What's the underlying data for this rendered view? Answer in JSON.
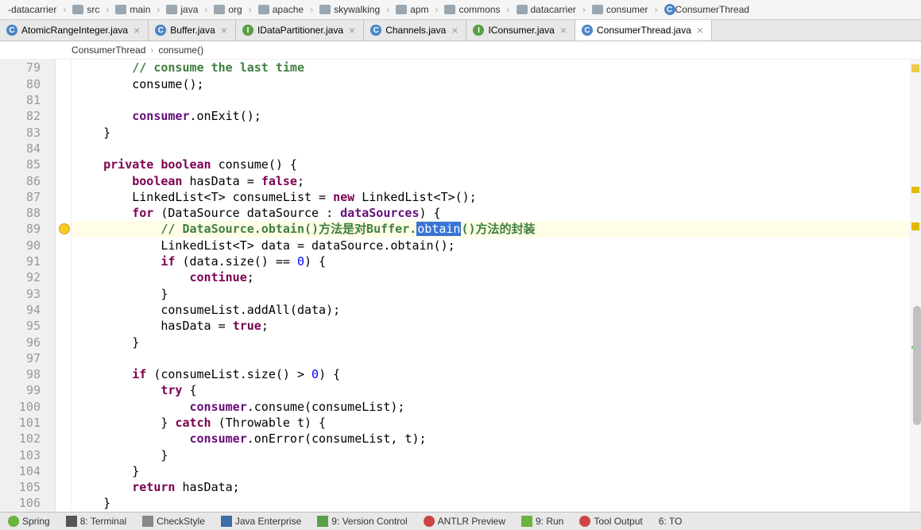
{
  "breadcrumbs": [
    "-datacarrier",
    "src",
    "main",
    "java",
    "org",
    "apache",
    "skywalking",
    "apm",
    "commons",
    "datacarrier",
    "consumer",
    "ConsumerThread"
  ],
  "bc_last_type": "class",
  "tabs": [
    {
      "icon": "c",
      "label": "AtomicRangeInteger.java",
      "active": false
    },
    {
      "icon": "c",
      "label": "Buffer.java",
      "active": false
    },
    {
      "icon": "i",
      "label": "IDataPartitioner.java",
      "active": false
    },
    {
      "icon": "c",
      "label": "Channels.java",
      "active": false
    },
    {
      "icon": "i",
      "label": "IConsumer.java",
      "active": false
    },
    {
      "icon": "c",
      "label": "ConsumerThread.java",
      "active": true
    }
  ],
  "navpath": {
    "class": "ConsumerThread",
    "method": "consume()"
  },
  "lines": {
    "start": 79,
    "end": 106,
    "highlighted": 89
  },
  "code": {
    "79": [
      {
        "t": "        ",
        "c": ""
      },
      {
        "t": "// consume the last time",
        "c": "comment-strong"
      }
    ],
    "80": [
      {
        "t": "        consume();",
        "c": ""
      }
    ],
    "81": [
      {
        "t": "",
        "c": ""
      }
    ],
    "82": [
      {
        "t": "        ",
        "c": ""
      },
      {
        "t": "consumer",
        "c": "field"
      },
      {
        "t": ".onExit();",
        "c": ""
      }
    ],
    "83": [
      {
        "t": "    }",
        "c": ""
      }
    ],
    "84": [
      {
        "t": "",
        "c": ""
      }
    ],
    "85": [
      {
        "t": "    ",
        "c": ""
      },
      {
        "t": "private boolean",
        "c": "kw"
      },
      {
        "t": " consume() {",
        "c": ""
      }
    ],
    "86": [
      {
        "t": "        ",
        "c": ""
      },
      {
        "t": "boolean",
        "c": "kw"
      },
      {
        "t": " hasData = ",
        "c": ""
      },
      {
        "t": "false",
        "c": "kw"
      },
      {
        "t": ";",
        "c": ""
      }
    ],
    "87": [
      {
        "t": "        LinkedList<",
        "c": ""
      },
      {
        "t": "T",
        "c": "type"
      },
      {
        "t": "> consumeList = ",
        "c": ""
      },
      {
        "t": "new",
        "c": "kw"
      },
      {
        "t": " LinkedList<",
        "c": ""
      },
      {
        "t": "T",
        "c": "type"
      },
      {
        "t": ">();",
        "c": ""
      }
    ],
    "88": [
      {
        "t": "        ",
        "c": ""
      },
      {
        "t": "for",
        "c": "kw"
      },
      {
        "t": " (DataSource dataSource : ",
        "c": ""
      },
      {
        "t": "dataSources",
        "c": "field"
      },
      {
        "t": ") {",
        "c": ""
      }
    ],
    "89": [
      {
        "t": "            ",
        "c": ""
      },
      {
        "t": "// DataSource.obtain()方法是对Buffer.",
        "c": "comment-strong"
      },
      {
        "t": "obtain",
        "c": "sel"
      },
      {
        "t": "()方法的封装",
        "c": "comment-strong"
      }
    ],
    "90": [
      {
        "t": "            LinkedList<",
        "c": ""
      },
      {
        "t": "T",
        "c": "type"
      },
      {
        "t": "> data = dataSource.obtain();",
        "c": ""
      }
    ],
    "91": [
      {
        "t": "            ",
        "c": ""
      },
      {
        "t": "if",
        "c": "kw"
      },
      {
        "t": " (data.size() == ",
        "c": ""
      },
      {
        "t": "0",
        "c": "num"
      },
      {
        "t": ") {",
        "c": ""
      }
    ],
    "92": [
      {
        "t": "                ",
        "c": ""
      },
      {
        "t": "continue",
        "c": "kw"
      },
      {
        "t": ";",
        "c": ""
      }
    ],
    "93": [
      {
        "t": "            }",
        "c": ""
      }
    ],
    "94": [
      {
        "t": "            consumeList.addAll(data);",
        "c": ""
      }
    ],
    "95": [
      {
        "t": "            hasData = ",
        "c": ""
      },
      {
        "t": "true",
        "c": "kw"
      },
      {
        "t": ";",
        "c": ""
      }
    ],
    "96": [
      {
        "t": "        }",
        "c": ""
      }
    ],
    "97": [
      {
        "t": "",
        "c": ""
      }
    ],
    "98": [
      {
        "t": "        ",
        "c": ""
      },
      {
        "t": "if",
        "c": "kw"
      },
      {
        "t": " (consumeList.size() > ",
        "c": ""
      },
      {
        "t": "0",
        "c": "num"
      },
      {
        "t": ") {",
        "c": ""
      }
    ],
    "99": [
      {
        "t": "            ",
        "c": ""
      },
      {
        "t": "try",
        "c": "kw"
      },
      {
        "t": " {",
        "c": ""
      }
    ],
    "100": [
      {
        "t": "                ",
        "c": ""
      },
      {
        "t": "consumer",
        "c": "field"
      },
      {
        "t": ".consume(consumeList);",
        "c": ""
      }
    ],
    "101": [
      {
        "t": "            } ",
        "c": ""
      },
      {
        "t": "catch",
        "c": "kw"
      },
      {
        "t": " (Throwable t) {",
        "c": ""
      }
    ],
    "102": [
      {
        "t": "                ",
        "c": ""
      },
      {
        "t": "consumer",
        "c": "field"
      },
      {
        "t": ".onError(consumeList, t);",
        "c": ""
      }
    ],
    "103": [
      {
        "t": "            }",
        "c": ""
      }
    ],
    "104": [
      {
        "t": "        }",
        "c": ""
      }
    ],
    "105": [
      {
        "t": "        ",
        "c": ""
      },
      {
        "t": "return",
        "c": "kw"
      },
      {
        "t": " hasData;",
        "c": ""
      }
    ],
    "106": [
      {
        "t": "    }",
        "c": ""
      }
    ]
  },
  "bottombar": [
    {
      "icon": "spring-icon",
      "label": "Spring"
    },
    {
      "icon": "term-icon",
      "label": "8: Terminal"
    },
    {
      "icon": "cs-icon",
      "label": "CheckStyle"
    },
    {
      "icon": "ent-icon",
      "label": "Java Enterprise"
    },
    {
      "icon": "vcs-icon",
      "label": "9: Version Control"
    },
    {
      "icon": "antlr-icon",
      "label": "ANTLR Preview"
    },
    {
      "icon": "run-icon",
      "label": "9: Run"
    },
    {
      "icon": "tool-icon",
      "label": "Tool Output"
    },
    {
      "icon": "",
      "label": "6: TO"
    }
  ]
}
